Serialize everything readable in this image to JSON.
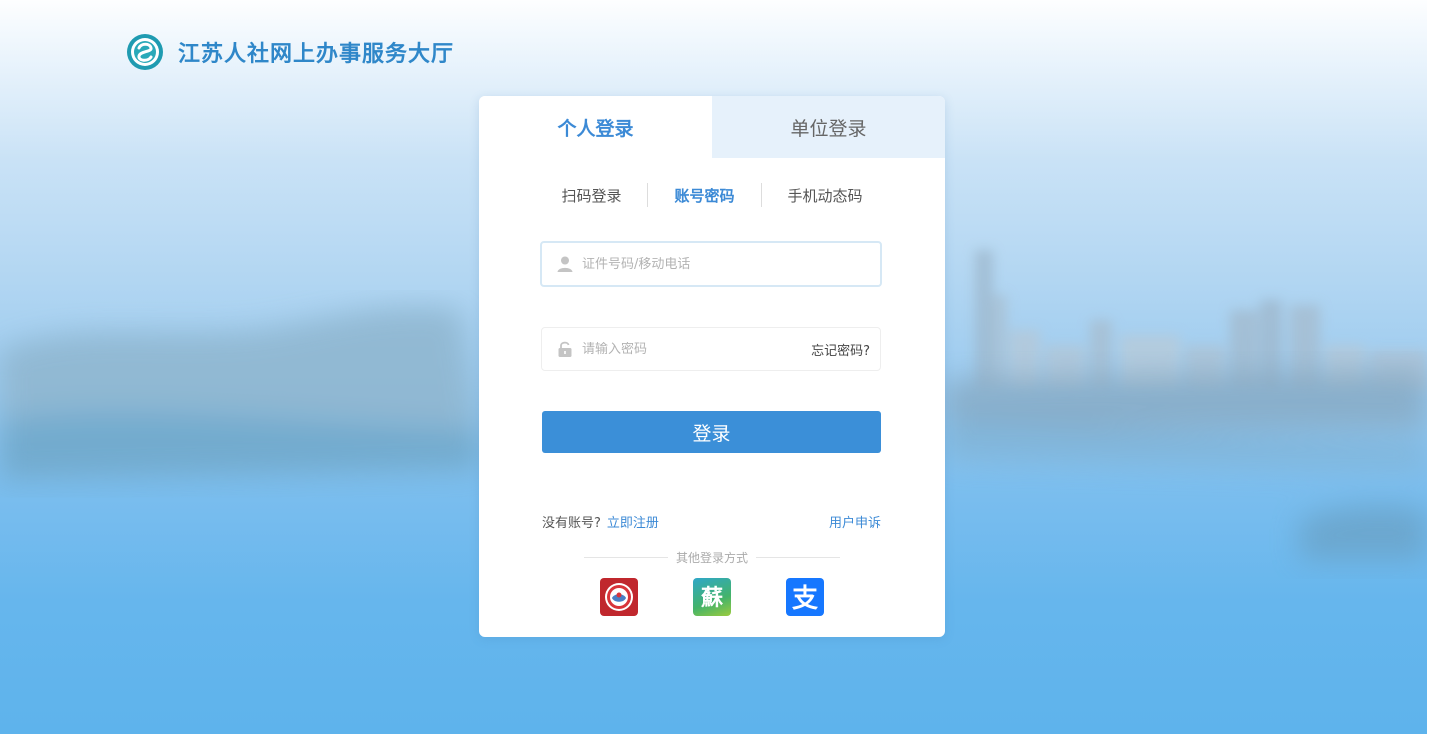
{
  "header": {
    "title": "江苏人社网上办事服务大厅",
    "logo_icon": "jiangsu-hrss-logo-icon"
  },
  "tabs": [
    {
      "label": "个人登录",
      "active": true
    },
    {
      "label": "单位登录",
      "active": false
    }
  ],
  "login_methods": [
    {
      "label": "扫码登录",
      "active": false
    },
    {
      "label": "账号密码",
      "active": true
    },
    {
      "label": "手机动态码",
      "active": false
    }
  ],
  "form": {
    "username": {
      "placeholder": "证件号码/移动电话",
      "value": "",
      "icon": "user-icon"
    },
    "password": {
      "placeholder": "请输入密码",
      "value": "",
      "icon": "lock-icon"
    },
    "forgot_label": "忘记密码?",
    "submit_label": "登录"
  },
  "footer": {
    "no_account": "没有账号?",
    "register": "立即注册",
    "appeal": "用户申诉",
    "other_methods": "其他登录方式"
  },
  "third_party": [
    {
      "name": "hrss-app-icon",
      "color": "#c0272d"
    },
    {
      "name": "su-service-icon",
      "color": "#3aa86b"
    },
    {
      "name": "alipay-icon",
      "color": "#1677ff"
    }
  ],
  "colors": {
    "accent": "#3c8ad6",
    "button": "#3b8fd8",
    "inactive_tab_bg": "#e6f1fb"
  }
}
